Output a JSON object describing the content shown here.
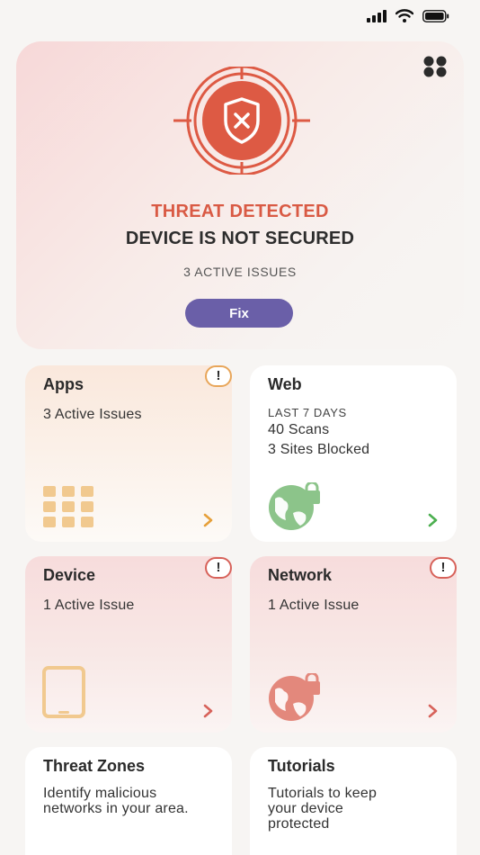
{
  "status_bar": {
    "icons": [
      "cellular-signal-icon",
      "wifi-icon",
      "battery-icon"
    ]
  },
  "hero": {
    "menu_icon": "grid-dots-icon",
    "status_icon": "shield-target-icon",
    "threat_title": "THREAT DETECTED",
    "device_status": "DEVICE IS NOT SECURED",
    "active_issues": "3 ACTIVE ISSUES",
    "fix_label": "Fix",
    "colors": {
      "alert": "#d95a44",
      "button": "#6a5fa8"
    }
  },
  "tiles": {
    "apps": {
      "title": "Apps",
      "text": "3 Active Issues",
      "icon": "apps-grid-icon",
      "badge": "!",
      "badge_color": "#e8a65a"
    },
    "web": {
      "title": "Web",
      "period": "LAST 7 DAYS",
      "scans": "40 Scans",
      "blocked": "3 Sites Blocked",
      "icon": "globe-lock-icon",
      "icon_color": "#8cc48a"
    },
    "device": {
      "title": "Device",
      "text": "1 Active Issue",
      "icon": "tablet-icon",
      "badge": "!",
      "badge_color": "#d7625a"
    },
    "network": {
      "title": "Network",
      "text": "1 Active Issue",
      "icon": "globe-lock-icon",
      "badge": "!",
      "badge_color": "#d7625a"
    },
    "threat_zones": {
      "title": "Threat Zones",
      "line1": "Identify malicious",
      "line2": "networks in your area."
    },
    "tutorials": {
      "title": "Tutorials",
      "line1": "Tutorials to keep",
      "line2": "your device",
      "line3": "protected"
    }
  }
}
